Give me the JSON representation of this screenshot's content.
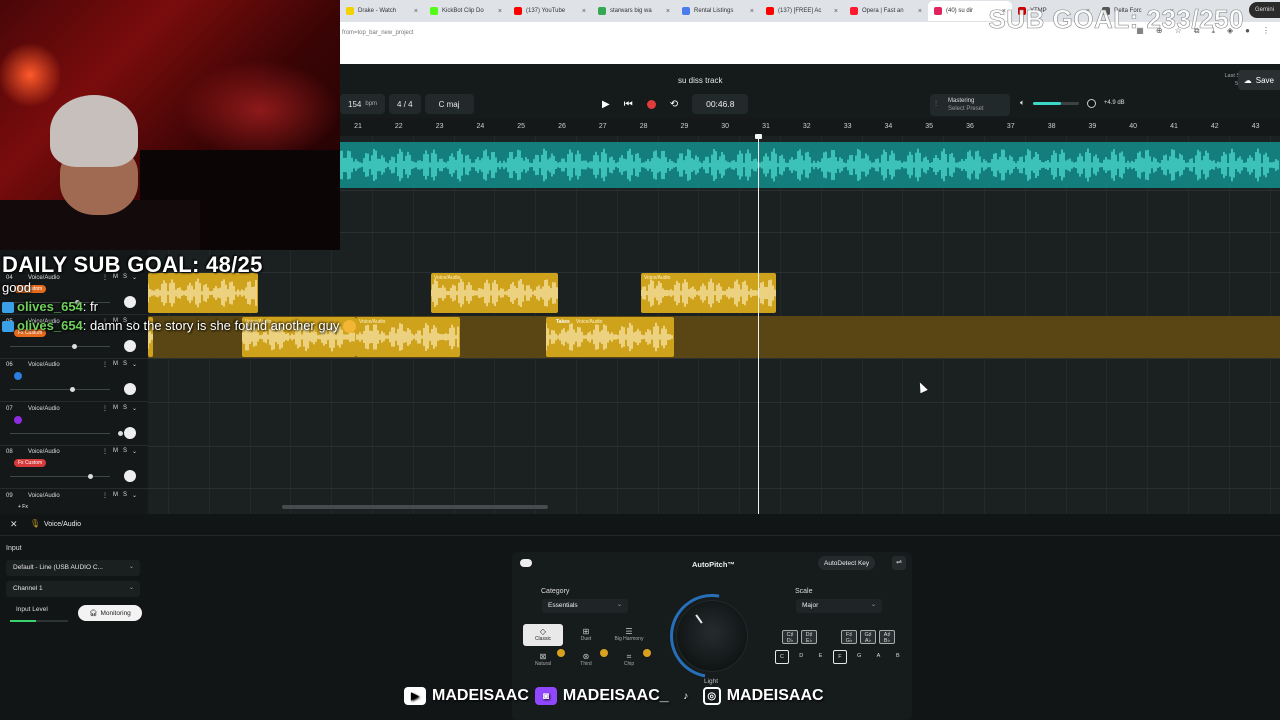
{
  "browser": {
    "tabs": [
      {
        "label": "Drake - Watch",
        "color": "#f1d300"
      },
      {
        "label": "KickBot Clip Do",
        "color": "#53fc18"
      },
      {
        "label": "(137) YouTube",
        "color": "#ff0000"
      },
      {
        "label": "starwars big wa",
        "color": "#34a853"
      },
      {
        "label": "Rental Listings",
        "color": "#4b7bec"
      },
      {
        "label": "(137) [FREE] Ac",
        "color": "#ff0000"
      },
      {
        "label": "Opera | Fast an",
        "color": "#ff1b2d"
      },
      {
        "label": "(40) su dir",
        "color": "#e0245e",
        "active": true
      },
      {
        "label": "YTMP",
        "color": "#cc0000"
      },
      {
        "label": "Delta Forc",
        "color": "#555555"
      }
    ],
    "tab_close": "×",
    "url": "from=top_bar_new_project",
    "gemini_label": "Gemini"
  },
  "overlay": {
    "sub_goal": "SUB GOAL: 233/250",
    "daily_goal": "DAILY SUB GOAL: 48/25",
    "chat": [
      {
        "user": "",
        "text": "good"
      },
      {
        "user": "olives_654",
        "text": "fr"
      },
      {
        "user": "olives_654",
        "text": "damn so the story is she found another guy"
      }
    ],
    "socials": [
      "MADEISAAC",
      "MADEISAAC_",
      "MADEISAAC"
    ]
  },
  "daw": {
    "project_title": "su diss track",
    "last_saved_label": "Last Saved",
    "last_saved_value": "5d ago",
    "save_label": "Save",
    "bpm": "154",
    "bpm_unit": "bpm",
    "time_signature": "4 / 4",
    "key": "C maj",
    "time": "00:46.8",
    "mastering_title": "Mastering",
    "mastering_sub": "Select Preset",
    "gain": "+4.9 dB",
    "volume_level": 0.62,
    "ruler": [
      "21",
      "22",
      "23",
      "24",
      "25",
      "26",
      "27",
      "28",
      "29",
      "30",
      "31",
      "32",
      "33",
      "34",
      "35",
      "36",
      "37",
      "38",
      "39",
      "40",
      "41",
      "42",
      "43"
    ],
    "tracks": [
      {
        "num": "04",
        "name": "Voice/Audio",
        "fx": "Fx Custom",
        "fx_color": "#e46a1e"
      },
      {
        "num": "05",
        "name": "Voice/Audio",
        "fx": "Fx Custom",
        "fx_color": "#e46a1e"
      },
      {
        "num": "06",
        "name": "Voice/Audio",
        "fx": "",
        "fx_color": "#2b7ee0"
      },
      {
        "num": "07",
        "name": "Voice/Audio",
        "fx": "",
        "fx_color": "#8e2de0"
      },
      {
        "num": "08",
        "name": "Voice/Audio",
        "fx": "Fx Custom",
        "fx_color": "#d73a3a"
      },
      {
        "num": "09",
        "name": "Voice/Audio",
        "fx": "+ Fx",
        "fx_color": "transparent"
      }
    ],
    "track_m": "M",
    "track_s": "S",
    "clip_label": "Voice/Audio",
    "takes_label": "Takes"
  },
  "panel": {
    "track_name": "Voice/Audio",
    "input_label": "Input",
    "input_device": "Default - Line (USB AUDIO C...",
    "channel": "Channel 1",
    "input_level_label": "Input Level",
    "input_level": 0.45,
    "monitoring_label": "Monitoring"
  },
  "autopitch": {
    "title": "AutoPitch™",
    "detect_label": "AutoDetect Key",
    "category_label": "Category",
    "category_value": "Essentials",
    "presets": [
      "Classic",
      "Duet",
      "Big Harmony",
      "Natural",
      "Third",
      "Chip"
    ],
    "knob_label": "Light",
    "scale_label": "Scale",
    "scale_value": "Major",
    "black_keys": [
      "C♯ D♭",
      "D♯ E♭",
      "F♯ G♭",
      "G♯ A♭",
      "A♯ B♭"
    ],
    "white_keys": [
      "C",
      "D",
      "E",
      "F",
      "G",
      "A",
      "B"
    ]
  },
  "colors": {
    "accent": "#39d8c9",
    "clip": "#cfa21c",
    "record": "#e23b3b"
  }
}
